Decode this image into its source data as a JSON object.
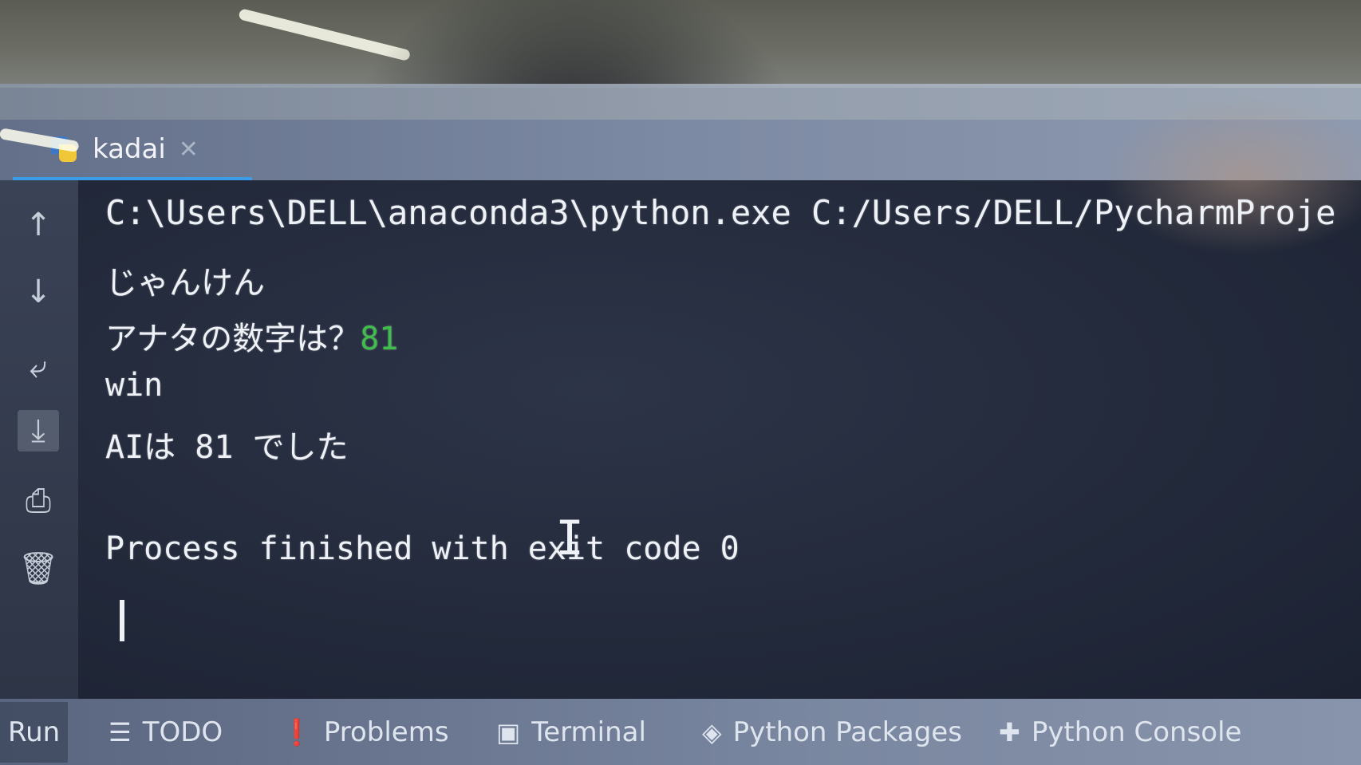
{
  "run_tab": {
    "label": "kadai",
    "close_icon": "close-icon",
    "file_icon": "python-file-icon",
    "accent_color": "#3d9ce8"
  },
  "gutter_icons": [
    "arrow-up-icon",
    "arrow-down-icon",
    "soft-wrap-icon",
    "scroll-to-end-icon",
    "print-icon",
    "trash-icon"
  ],
  "console": {
    "command_line": "C:\\Users\\DELL\\anaconda3\\python.exe C:/Users/DELL/PycharmProje",
    "line_janken": "じゃんけん",
    "prompt_text": "アナタの数字は？",
    "user_input": "81",
    "input_color": "#3fbf49",
    "result": "win",
    "ai_result": "AIは 81 でした",
    "exit_message": "Process finished with exit code 0"
  },
  "status_bar": {
    "run_label": "Run",
    "todo_label": "TODO",
    "problems_label": "Problems",
    "terminal_label": "Terminal",
    "packages_label": "Python Packages",
    "console_label": "Python Console"
  }
}
